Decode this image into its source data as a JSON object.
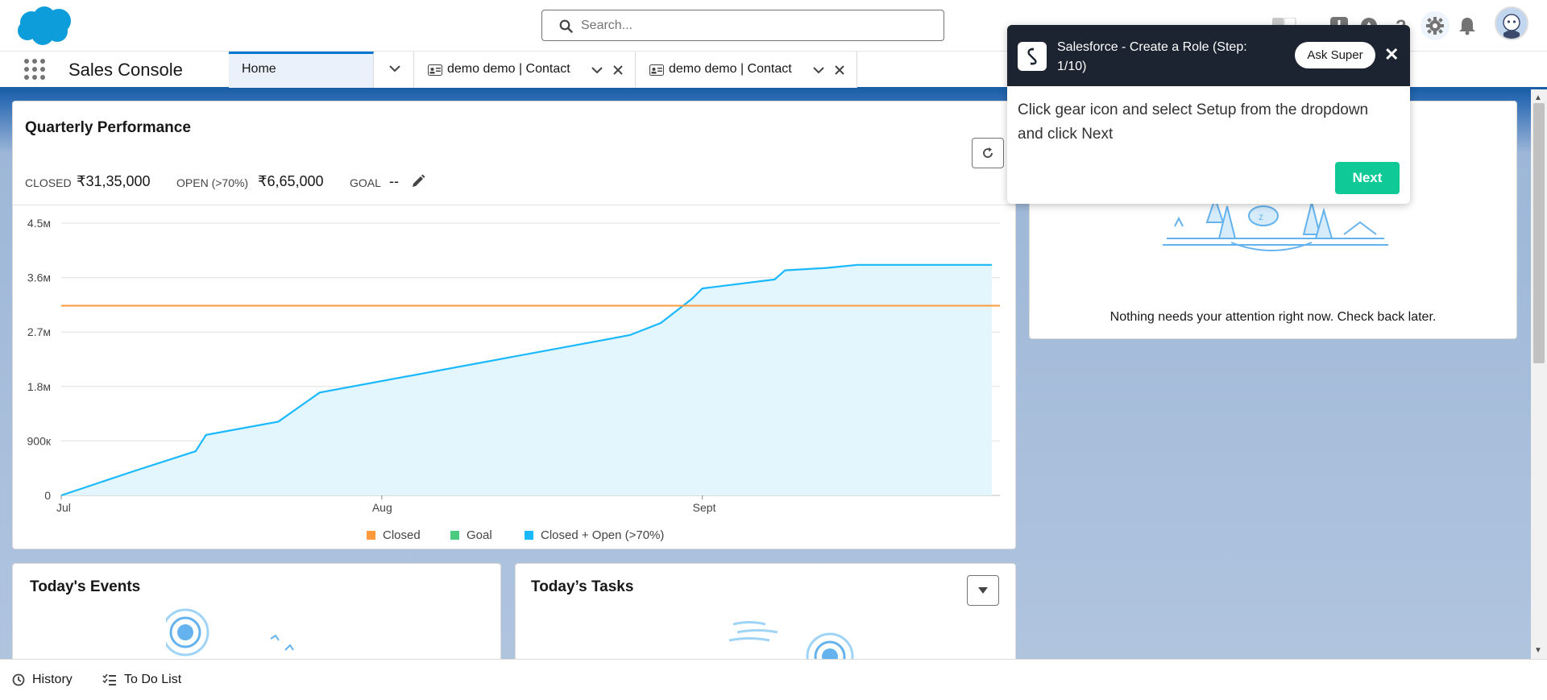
{
  "header": {
    "search_placeholder": "Search..."
  },
  "nav": {
    "app_name": "Sales Console",
    "tabs": [
      {
        "label": "Home"
      },
      {
        "label": "demo demo | Contact"
      },
      {
        "label": "demo demo | Contact"
      }
    ]
  },
  "quarterly": {
    "title": "Quarterly Performance",
    "closed_label": "CLOSED",
    "closed_value": "₹31,35,000",
    "open_label": "OPEN (>70%)",
    "open_value": "₹6,65,000",
    "goal_label": "GOAL",
    "goal_value": "--"
  },
  "chart_data": {
    "type": "area",
    "x_ticks": [
      "Jul",
      "Aug",
      "Sept"
    ],
    "y_ticks": [
      "0",
      "900к",
      "1.8м",
      "2.7м",
      "3.6м",
      "4.5м"
    ],
    "ylim": [
      0,
      4500000
    ],
    "x": [
      0,
      7,
      13,
      14,
      21,
      25,
      55,
      58,
      61,
      62,
      69,
      70,
      74,
      77,
      90
    ],
    "series": [
      {
        "name": "Closed + Open (>70%)",
        "color": "#1ab9ff",
        "values": [
          0,
          400000,
          730000,
          1000000,
          1220000,
          1700000,
          2650000,
          2850000,
          3250000,
          3420000,
          3570000,
          3720000,
          3760000,
          3810000,
          3810000
        ]
      },
      {
        "name": "Closed",
        "color": "#ff9a3c",
        "values": [
          3135000,
          3135000
        ]
      }
    ],
    "legend": [
      {
        "name": "Closed",
        "color": "#ff9a3c"
      },
      {
        "name": "Goal",
        "color": "#4bca81"
      },
      {
        "name": "Closed + Open (>70%)",
        "color": "#1ab9ff"
      }
    ],
    "grid": true
  },
  "assistant": {
    "message": "Nothing needs your attention right now. Check back later."
  },
  "events": {
    "title": "Today's Events"
  },
  "tasks": {
    "title": "Today’s Tasks"
  },
  "utility": {
    "history": "History",
    "todo": "To Do List"
  },
  "guide": {
    "title": "Salesforce - Create a Role (Step: 1/10)",
    "ask_label": "Ask Super",
    "body": "Click gear icon and select Setup from the dropdown and click Next",
    "next_label": "Next"
  }
}
